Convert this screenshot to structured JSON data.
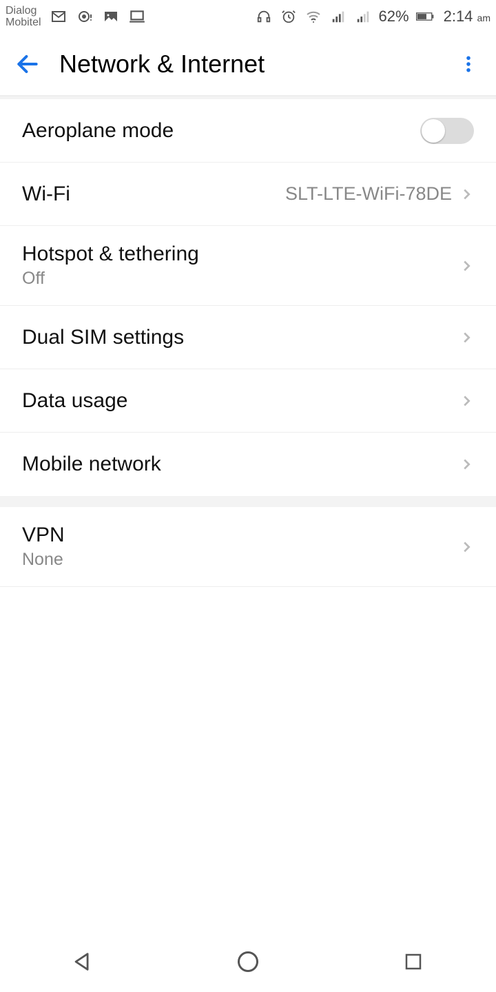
{
  "status": {
    "carrier_line1": "Dialog",
    "carrier_line2": "Mobitel",
    "battery_pct": "62%",
    "time": "2:14",
    "ampm": "am"
  },
  "appbar": {
    "title": "Network & Internet"
  },
  "items": {
    "aeroplane": {
      "title": "Aeroplane mode"
    },
    "wifi": {
      "title": "Wi-Fi",
      "value": "SLT-LTE-WiFi-78DE"
    },
    "hotspot": {
      "title": "Hotspot & tethering",
      "sub": "Off"
    },
    "dualsim": {
      "title": "Dual SIM settings"
    },
    "datausage": {
      "title": "Data usage"
    },
    "mobilenet": {
      "title": "Mobile network"
    },
    "vpn": {
      "title": "VPN",
      "sub": "None"
    }
  }
}
